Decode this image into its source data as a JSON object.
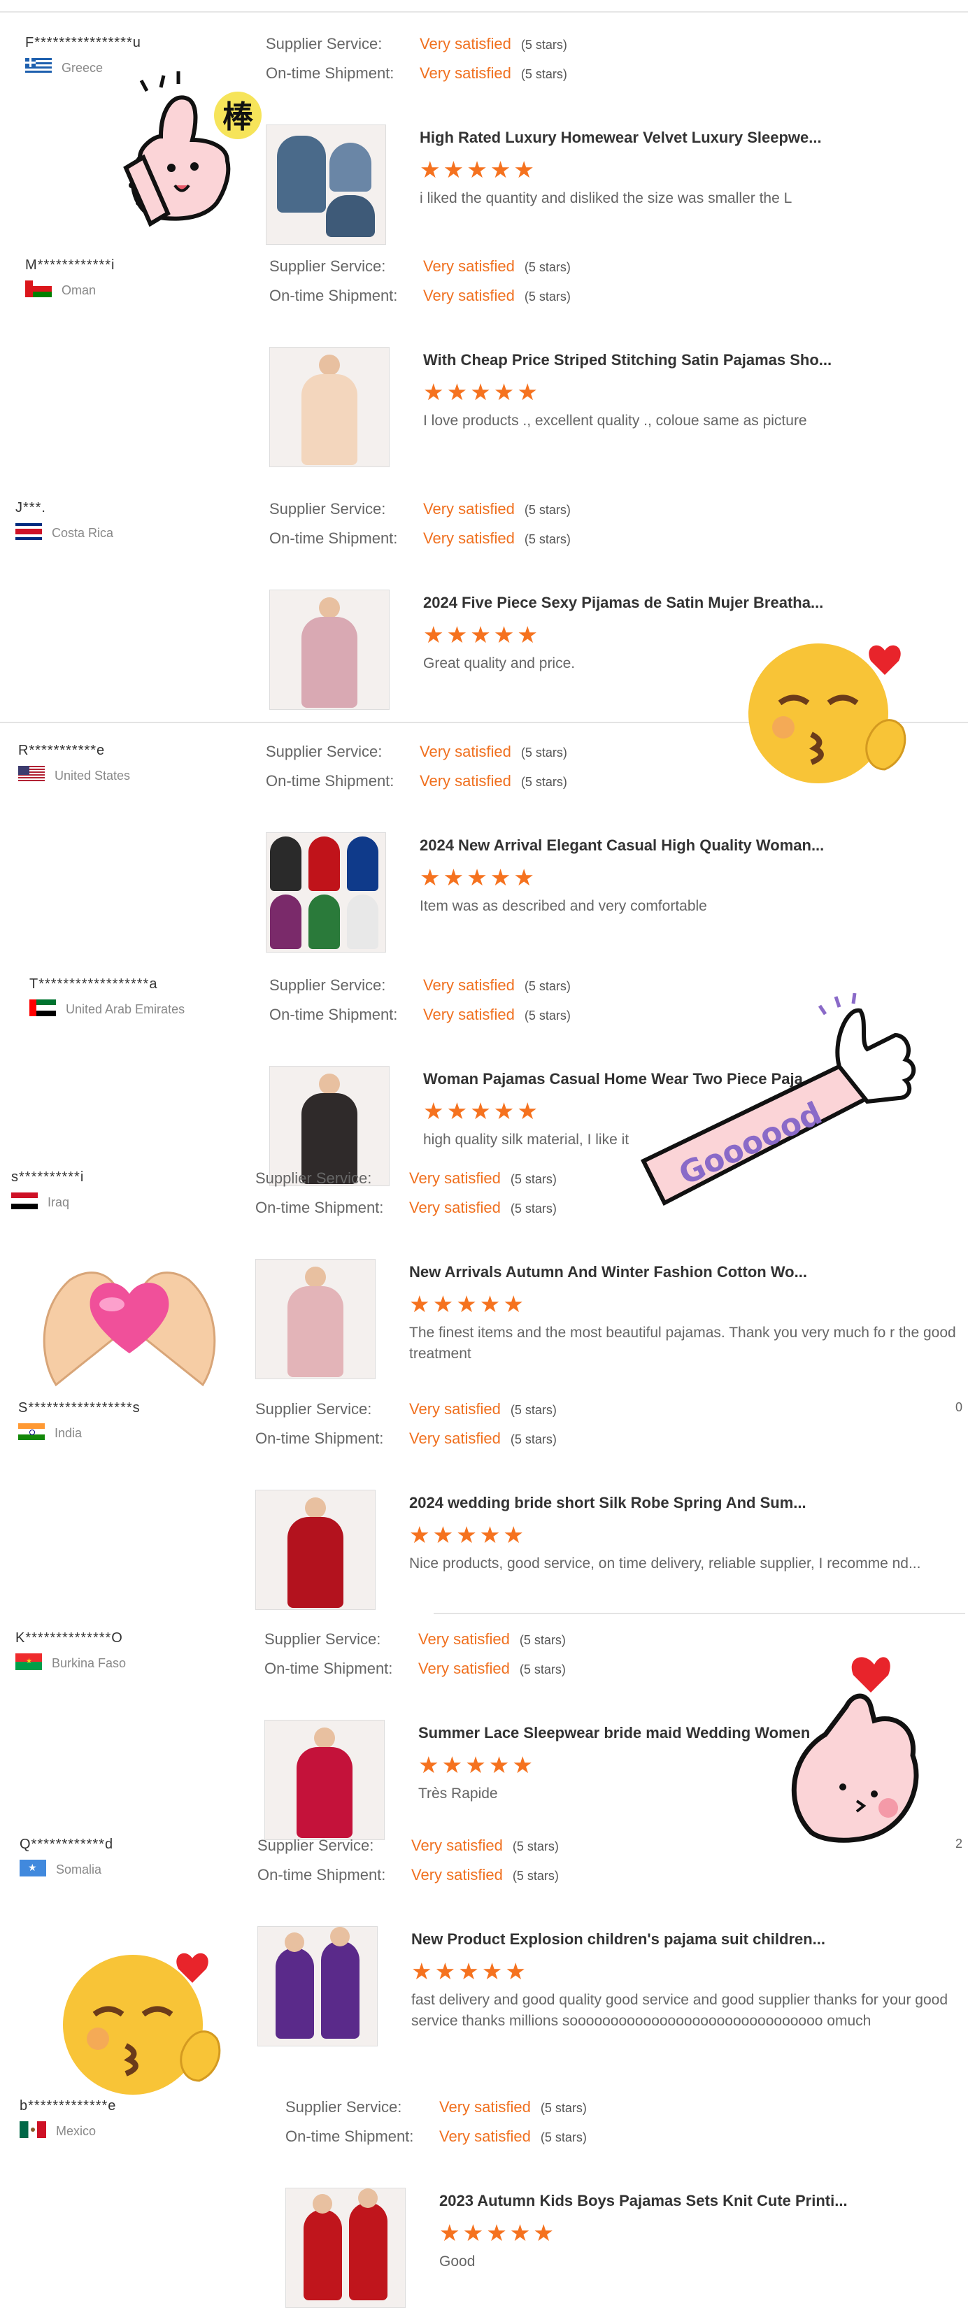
{
  "labels": {
    "supplier_service": "Supplier Service:",
    "on_time_shipment": "On-time Shipment:",
    "very_satisfied": "Very satisfied",
    "five_stars": "(5 stars)"
  },
  "reviews": [
    {
      "name": "F****************u",
      "country": "Greece",
      "flag": "greece",
      "title": "High Rated Luxury Homewear Velvet Luxury Sleepwe...",
      "comment": "i liked the quantity and disliked the size was smaller the L",
      "rating": 5,
      "thumb_color": "#4a6a8a"
    },
    {
      "name": "M************i",
      "country": "Oman",
      "flag": "oman",
      "title": "With Cheap Price Striped Stitching Satin Pajamas Sho...",
      "comment": "I love products ., excellent quality ., coloue same as picture",
      "rating": 5,
      "thumb_color": "#f3d6bd"
    },
    {
      "name": "J***.",
      "country": "Costa Rica",
      "flag": "costa-rica",
      "title": "2024 Five Piece Sexy Pijamas de Satin Mujer Breatha...",
      "comment": "Great quality and price.",
      "rating": 5,
      "thumb_color": "#d9a9b3"
    },
    {
      "name": "R***********e",
      "country": "United States",
      "flag": "united-states",
      "title": "2024 New Arrival Elegant Casual High Quality Woman...",
      "comment": "Item was as described and very comfortable",
      "rating": 5,
      "thumb_color": "#7a2a6a"
    },
    {
      "name": "T******************a",
      "country": "United Arab Emirates",
      "flag": "uae",
      "title": "Woman Pajamas Casual Home Wear Two Piece Paja...",
      "comment": "high quality silk material, I like it",
      "rating": 5,
      "thumb_color": "#2f2a2a"
    },
    {
      "name": "s**********i",
      "country": "Iraq",
      "flag": "iraq",
      "title": "New Arrivals Autumn And Winter Fashion Cotton Wo...",
      "comment": "The finest items and the most beautiful pajamas. Thank you very much fo r the good treatment",
      "rating": 5,
      "thumb_color": "#e3b4b8"
    },
    {
      "name": "S*****************s",
      "country": "India",
      "flag": "india",
      "title": "2024 wedding bride short Silk Robe Spring And Sum...",
      "comment": "Nice products, good service, on time delivery, reliable supplier, I recomme nd...",
      "rating": 5,
      "thumb_color": "#b3121e",
      "extra": "0"
    },
    {
      "name": "K**************O",
      "country": "Burkina Faso",
      "flag": "burkina-faso",
      "title": "Summer Lace Sleepwear bride maid Wedding Women",
      "comment": "Très Rapide",
      "rating": 5,
      "thumb_color": "#c4123a"
    },
    {
      "name": "Q************d",
      "country": "Somalia",
      "flag": "somalia",
      "title": "New Product Explosion children's pajama suit children...",
      "comment": "fast delivery and good quality good service and good supplier  thanks for your good service thanks millions sooooooooooooooooooooooooooooooo omuch",
      "rating": 5,
      "thumb_color": "#5a2a8a",
      "extra": "2"
    },
    {
      "name": "b*************e",
      "country": "Mexico",
      "flag": "mexico",
      "title": "2023 Autumn Kids Boys Pajamas Sets Knit Cute Printi...",
      "comment": "Good",
      "rating": 5,
      "thumb_color": "#c0151c"
    }
  ],
  "stickers": {
    "thumbs_up_char": "棒",
    "goooood_text": "Goooood"
  }
}
